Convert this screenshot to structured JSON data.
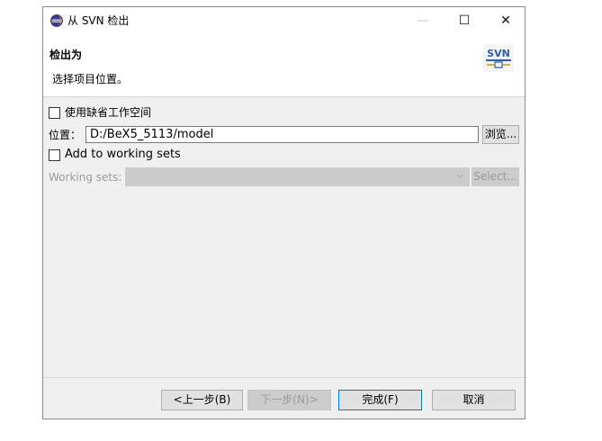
{
  "window": {
    "title": "从 SVN 检出",
    "controls": {
      "minimize": "—",
      "maximize": "☐",
      "close": "✕"
    }
  },
  "header": {
    "title": "检出为",
    "description": "选择项目位置。",
    "logo_text": "SVN"
  },
  "form": {
    "use_default_workspace_label": "使用缺省工作空间",
    "location_label": "位置：",
    "location_value": "D:/BeX5_5113/model",
    "browse_label": "浏览...",
    "add_to_working_sets_label": "Add to working sets",
    "working_sets_label": "Working sets:",
    "working_sets_select_label": "Select..."
  },
  "footer": {
    "back_label": "<上一步(B)",
    "next_label": "下一步(N)>",
    "finish_label": "完成(F)",
    "cancel_label": "取消"
  },
  "colors": {
    "accent": "#0078d7",
    "svn_blue": "#2a5da8"
  }
}
